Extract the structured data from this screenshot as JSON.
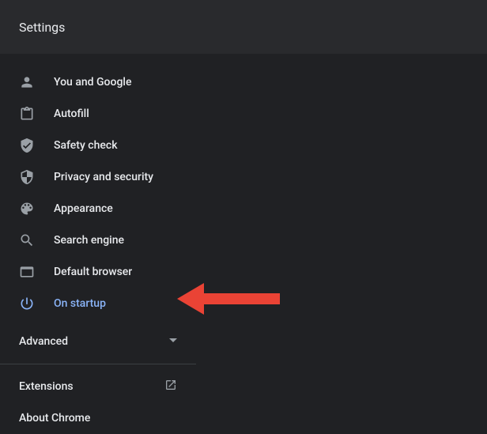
{
  "header": {
    "title": "Settings"
  },
  "sidebar": {
    "items": [
      {
        "label": "You and Google",
        "icon": "person-icon",
        "selected": false
      },
      {
        "label": "Autofill",
        "icon": "autofill-icon",
        "selected": false
      },
      {
        "label": "Safety check",
        "icon": "safety-check-icon",
        "selected": false
      },
      {
        "label": "Privacy and security",
        "icon": "security-icon",
        "selected": false
      },
      {
        "label": "Appearance",
        "icon": "appearance-icon",
        "selected": false
      },
      {
        "label": "Search engine",
        "icon": "search-icon",
        "selected": false
      },
      {
        "label": "Default browser",
        "icon": "default-browser-icon",
        "selected": false
      },
      {
        "label": "On startup",
        "icon": "power-icon",
        "selected": true
      }
    ],
    "advanced": "Advanced",
    "extensions": "Extensions",
    "about": "About Chrome"
  },
  "annotation": {
    "arrow_color": "#ea4335"
  }
}
